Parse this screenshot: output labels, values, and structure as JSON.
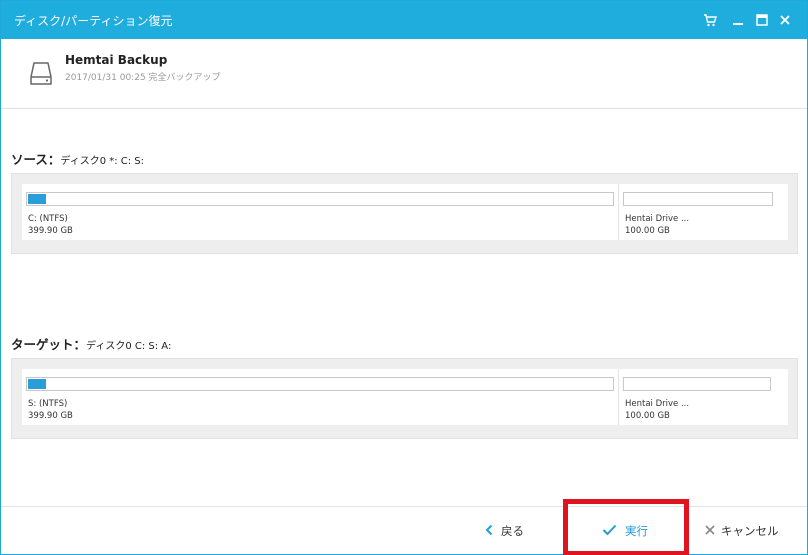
{
  "window": {
    "title": "ディスク/パーティション復元",
    "accent_color": "#1fadde",
    "controls": [
      "cart-icon",
      "minimize-icon",
      "maximize-icon",
      "close-icon"
    ]
  },
  "backup": {
    "name": "Hemtai Backup",
    "meta": "2017/01/31 00:25 完全バックアップ",
    "icon": "drive-icon"
  },
  "source": {
    "heading": "ソース：",
    "disk_text": "ディスク0 *: C: S:",
    "partitions": [
      {
        "name": "C: (NTFS)",
        "size": "399.90 GB",
        "used_fraction": 0.03
      },
      {
        "name": "Hentai Drive ...",
        "size": "100.00 GB",
        "used_fraction": 0
      }
    ]
  },
  "target": {
    "heading": "ターゲット：",
    "disk_text": "ディスク0 C: S: A:",
    "partitions": [
      {
        "name": "S: (NTFS)",
        "size": "399.90 GB",
        "used_fraction": 0.03
      },
      {
        "name": "Hentai Drive ...",
        "size": "100.00 GB",
        "used_fraction": 0
      }
    ]
  },
  "footer": {
    "back_label": "戻る",
    "execute_label": "実行",
    "cancel_label": "キャンセル",
    "highlight_color": "#e0141e"
  }
}
